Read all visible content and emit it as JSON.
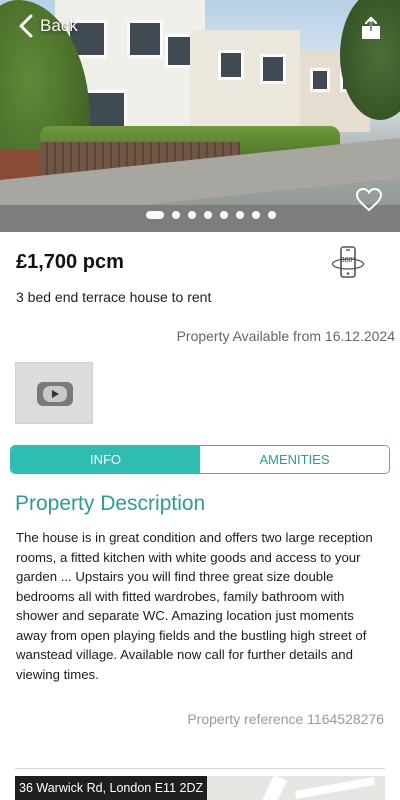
{
  "header": {
    "back_label": "Back"
  },
  "icons": {
    "back": "chevron-left-icon",
    "share": "share-icon",
    "favorite": "heart-icon",
    "tour": "360-view-icon",
    "video": "play-icon"
  },
  "carousel": {
    "total": 8,
    "active_index": 0
  },
  "listing": {
    "price": "£1,700 pcm",
    "summary": "3 bed end terrace house to rent",
    "availability": "Property Available from 16.12.2024",
    "tour_badge": "360°"
  },
  "tabs": [
    {
      "label": "INFO",
      "active": true
    },
    {
      "label": "AMENITIES",
      "active": false
    }
  ],
  "description": {
    "title": "Property Description",
    "text": "The house is in great condition and offers two large reception rooms, a fitted kitchen with white goods and access to your garden ... Upstairs you will find three great size double bedrooms all with fitted wardrobes, family bathroom with shower and separate WC. Amazing location just moments away from open playing fields and the bustling high street of wanstead village. Available now call for further details and viewing times."
  },
  "reference": "Property reference 1164528276",
  "map": {
    "address": "36 Warwick Rd, London E11 2DZ"
  },
  "colors": {
    "accent": "#2ebdb0",
    "accent_text": "#2a9e94",
    "muted_text": "#9a9a9a"
  }
}
